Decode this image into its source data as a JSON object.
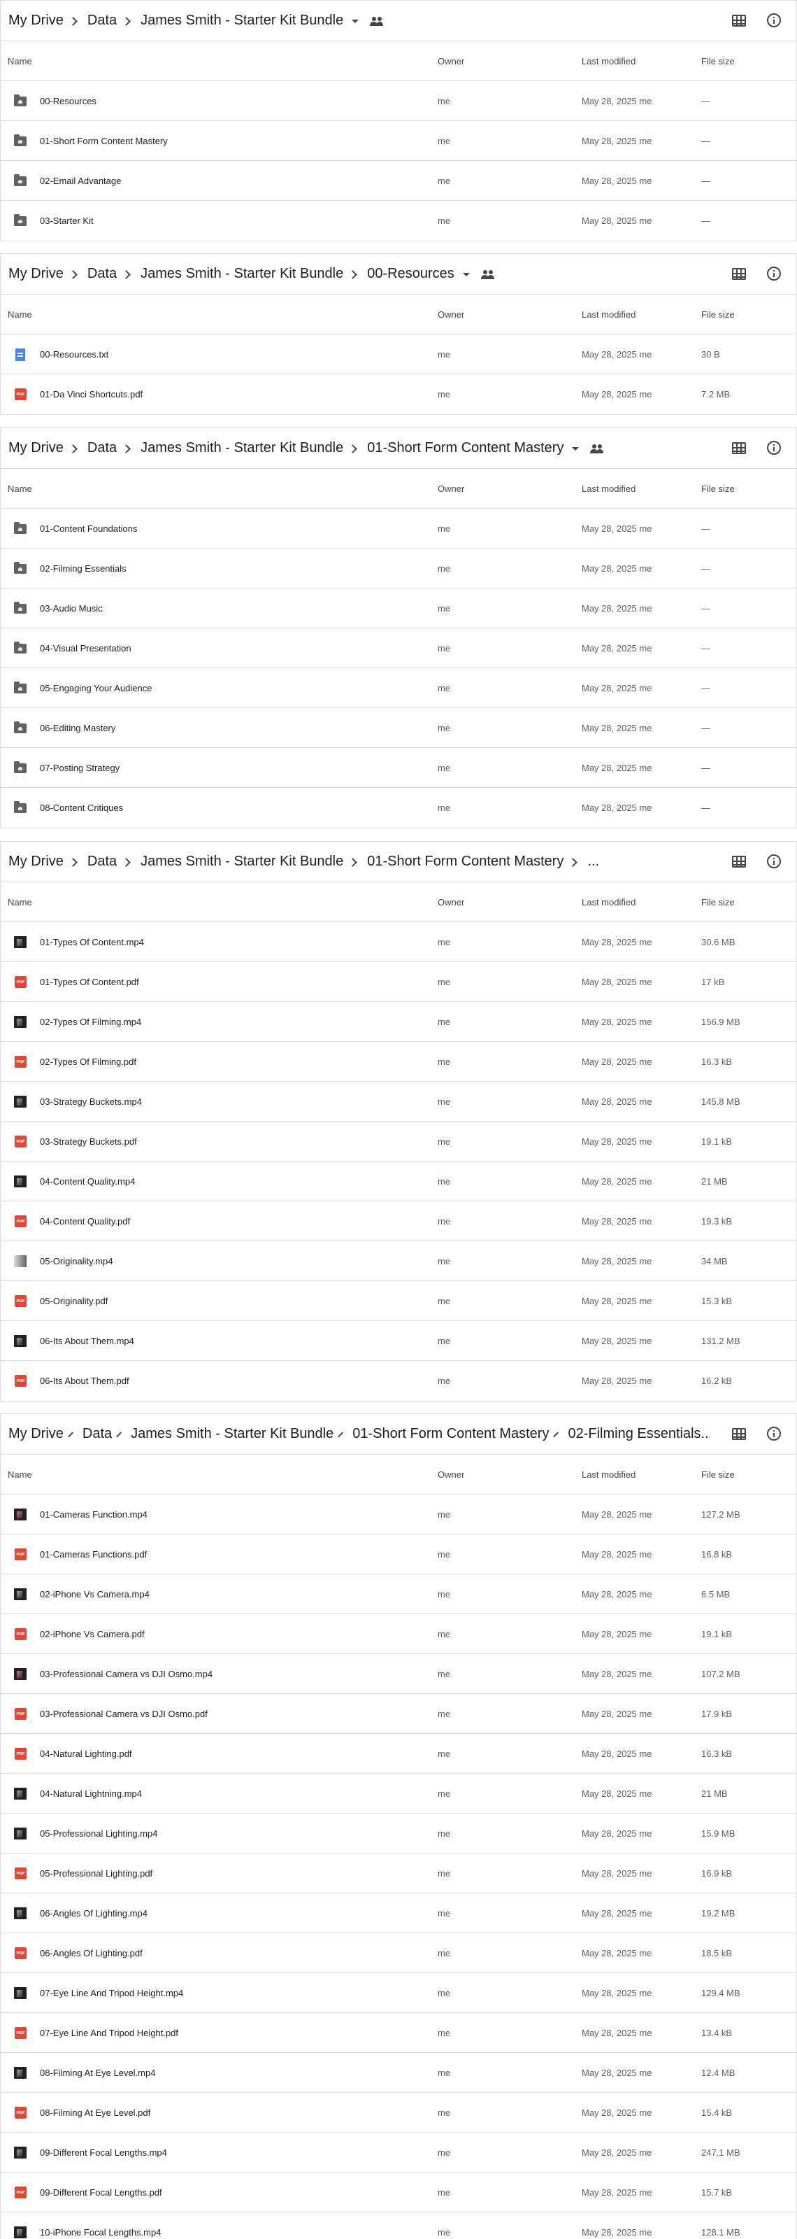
{
  "columns": {
    "name": "Name",
    "owner": "Owner",
    "modified": "Last modified",
    "size": "File size"
  },
  "colors": {
    "folder": "#5f6368",
    "doc": "#4285f4",
    "pdf": "#ea4335",
    "border": "#dadce0"
  },
  "panels": [
    {
      "breadcrumbs": [
        "My Drive",
        "Data",
        "James Smith - Starter Kit Bundle"
      ],
      "dropdown": true,
      "shared_icon": true,
      "truncated": false,
      "rows": [
        {
          "icon": "folder-icon",
          "name": "00-Resources",
          "owner": "me",
          "modified": "May 28, 2025 me",
          "size": "—"
        },
        {
          "icon": "folder-icon",
          "name": "01-Short Form Content Mastery",
          "owner": "me",
          "modified": "May 28, 2025 me",
          "size": "—"
        },
        {
          "icon": "folder-icon",
          "name": "02-Email Advantage",
          "owner": "me",
          "modified": "May 28, 2025 me",
          "size": "—"
        },
        {
          "icon": "folder-icon",
          "name": "03-Starter Kit",
          "owner": "me",
          "modified": "May 28, 2025 me",
          "size": "—"
        }
      ]
    },
    {
      "breadcrumbs": [
        "My Drive",
        "Data",
        "James Smith - Starter Kit Bundle",
        "00-Resources"
      ],
      "dropdown": true,
      "shared_icon": true,
      "truncated": false,
      "rows": [
        {
          "icon": "doc-icon",
          "name": "00-Resources.txt",
          "owner": "me",
          "modified": "May 28, 2025 me",
          "size": "30 B"
        },
        {
          "icon": "pdf-icon",
          "name": "01-Da Vinci Shortcuts.pdf",
          "owner": "me",
          "modified": "May 28, 2025 me",
          "size": "7.2 MB"
        }
      ]
    },
    {
      "breadcrumbs": [
        "My Drive",
        "Data",
        "James Smith - Starter Kit Bundle",
        "01-Short Form Content Mastery"
      ],
      "dropdown": true,
      "shared_icon": true,
      "truncated": false,
      "rows": [
        {
          "icon": "folder-icon",
          "name": "01-Content Foundations",
          "owner": "me",
          "modified": "May 28, 2025 me",
          "size": "—"
        },
        {
          "icon": "folder-icon",
          "name": "02-Filming Essentials",
          "owner": "me",
          "modified": "May 28, 2025 me",
          "size": "—"
        },
        {
          "icon": "folder-icon",
          "name": "03-Audio Music",
          "owner": "me",
          "modified": "May 28, 2025 me",
          "size": "—"
        },
        {
          "icon": "folder-icon",
          "name": "04-Visual Presentation",
          "owner": "me",
          "modified": "May 28, 2025 me",
          "size": "—"
        },
        {
          "icon": "folder-icon",
          "name": "05-Engaging Your Audience",
          "owner": "me",
          "modified": "May 28, 2025 me",
          "size": "—"
        },
        {
          "icon": "folder-icon",
          "name": "06-Editing Mastery",
          "owner": "me",
          "modified": "May 28, 2025 me",
          "size": "—"
        },
        {
          "icon": "folder-icon",
          "name": "07-Posting Strategy",
          "owner": "me",
          "modified": "May 28, 2025 me",
          "size": "—"
        },
        {
          "icon": "folder-icon",
          "name": "08-Content Critiques",
          "owner": "me",
          "modified": "May 28, 2025 me",
          "size": "—"
        }
      ]
    },
    {
      "breadcrumbs": [
        "My Drive",
        "Data",
        "James Smith - Starter Kit Bundle",
        "01-Short Form Content Mastery",
        "..."
      ],
      "dropdown": false,
      "shared_icon": false,
      "truncated": true,
      "rows": [
        {
          "icon": "video-icon",
          "name": "01-Types Of Content.mp4",
          "owner": "me",
          "modified": "May 28, 2025 me",
          "size": "30.6 MB"
        },
        {
          "icon": "pdf-icon",
          "name": "01-Types Of Content.pdf",
          "owner": "me",
          "modified": "May 28, 2025 me",
          "size": "17 kB"
        },
        {
          "icon": "video-icon",
          "name": "02-Types Of Filming.mp4",
          "owner": "me",
          "modified": "May 28, 2025 me",
          "size": "156.9 MB"
        },
        {
          "icon": "pdf-icon",
          "name": "02-Types Of Filming.pdf",
          "owner": "me",
          "modified": "May 28, 2025 me",
          "size": "16.3 kB"
        },
        {
          "icon": "video-icon",
          "name": "03-Strategy Buckets.mp4",
          "owner": "me",
          "modified": "May 28, 2025 me",
          "size": "145.8 MB"
        },
        {
          "icon": "pdf-icon",
          "name": "03-Strategy Buckets.pdf",
          "owner": "me",
          "modified": "May 28, 2025 me",
          "size": "19.1 kB"
        },
        {
          "icon": "video-icon",
          "name": "04-Content Quality.mp4",
          "owner": "me",
          "modified": "May 28, 2025 me",
          "size": "21 MB"
        },
        {
          "icon": "pdf-icon",
          "name": "04-Content Quality.pdf",
          "owner": "me",
          "modified": "May 28, 2025 me",
          "size": "19.3 kB"
        },
        {
          "icon": "video-light-icon",
          "name": "05-Originality.mp4",
          "owner": "me",
          "modified": "May 28, 2025 me",
          "size": "34 MB"
        },
        {
          "icon": "pdf-icon",
          "name": "05-Originality.pdf",
          "owner": "me",
          "modified": "May 28, 2025 me",
          "size": "15.3 kB"
        },
        {
          "icon": "video-icon",
          "name": "06-Its About Them.mp4",
          "owner": "me",
          "modified": "May 28, 2025 me",
          "size": "131.2 MB"
        },
        {
          "icon": "pdf-icon",
          "name": "06-Its About Them.pdf",
          "owner": "me",
          "modified": "May 28, 2025 me",
          "size": "16.2 kB"
        }
      ]
    },
    {
      "breadcrumbs": [
        "My Drive",
        "Data",
        "James Smith - Starter Kit Bundle",
        "01-Short Form Content Mastery",
        "02-Filming Essentials..."
      ],
      "dropdown": false,
      "shared_icon": false,
      "truncated": true,
      "rows": [
        {
          "icon": "video-warm-icon",
          "name": "01-Cameras Function.mp4",
          "owner": "me",
          "modified": "May 28, 2025 me",
          "size": "127.2 MB"
        },
        {
          "icon": "pdf-icon",
          "name": "01-Cameras Functions.pdf",
          "owner": "me",
          "modified": "May 28, 2025 me",
          "size": "16.8 kB"
        },
        {
          "icon": "video-icon",
          "name": "02-iPhone Vs Camera.mp4",
          "owner": "me",
          "modified": "May 28, 2025 me",
          "size": "6.5 MB"
        },
        {
          "icon": "pdf-icon",
          "name": "02-iPhone Vs Camera.pdf",
          "owner": "me",
          "modified": "May 28, 2025 me",
          "size": "19.1 kB"
        },
        {
          "icon": "video-warm-icon",
          "name": "03-Professional Camera vs DJI Osmo.mp4",
          "owner": "me",
          "modified": "May 28, 2025 me",
          "size": "107.2 MB"
        },
        {
          "icon": "pdf-icon",
          "name": "03-Professional Camera vs DJI Osmo.pdf",
          "owner": "me",
          "modified": "May 28, 2025 me",
          "size": "17.9 kB"
        },
        {
          "icon": "pdf-icon",
          "name": "04-Natural Lighting.pdf",
          "owner": "me",
          "modified": "May 28, 2025 me",
          "size": "16.3 kB"
        },
        {
          "icon": "video-icon",
          "name": "04-Natural Lightning.mp4",
          "owner": "me",
          "modified": "May 28, 2025 me",
          "size": "21 MB"
        },
        {
          "icon": "video-icon",
          "name": "05-Professional Lighting.mp4",
          "owner": "me",
          "modified": "May 28, 2025 me",
          "size": "15.9 MB"
        },
        {
          "icon": "pdf-icon",
          "name": "05-Professional Lighting.pdf",
          "owner": "me",
          "modified": "May 28, 2025 me",
          "size": "16.9 kB"
        },
        {
          "icon": "video-icon",
          "name": "06-Angles Of Lighting.mp4",
          "owner": "me",
          "modified": "May 28, 2025 me",
          "size": "19.2 MB"
        },
        {
          "icon": "pdf-icon",
          "name": "06-Angles Of Lighting.pdf",
          "owner": "me",
          "modified": "May 28, 2025 me",
          "size": "18.5 kB"
        },
        {
          "icon": "video-icon",
          "name": "07-Eye Line And Tripod Height.mp4",
          "owner": "me",
          "modified": "May 28, 2025 me",
          "size": "129.4 MB"
        },
        {
          "icon": "pdf-icon",
          "name": "07-Eye Line And Tripod Height.pdf",
          "owner": "me",
          "modified": "May 28, 2025 me",
          "size": "13.4 kB"
        },
        {
          "icon": "video-icon",
          "name": "08-Filming At Eye Level.mp4",
          "owner": "me",
          "modified": "May 28, 2025 me",
          "size": "12.4 MB"
        },
        {
          "icon": "pdf-icon",
          "name": "08-Filming At Eye Level.pdf",
          "owner": "me",
          "modified": "May 28, 2025 me",
          "size": "15.4 kB"
        },
        {
          "icon": "video-icon",
          "name": "09-Different Focal Lengths.mp4",
          "owner": "me",
          "modified": "May 28, 2025 me",
          "size": "247.1 MB"
        },
        {
          "icon": "pdf-icon",
          "name": "09-Different Focal Lengths.pdf",
          "owner": "me",
          "modified": "May 28, 2025 me",
          "size": "15.7 kB"
        },
        {
          "icon": "video-icon",
          "name": "10-iPhone Focal Lengths.mp4",
          "owner": "me",
          "modified": "May 28, 2025 me",
          "size": "128.1 MB"
        }
      ]
    }
  ]
}
